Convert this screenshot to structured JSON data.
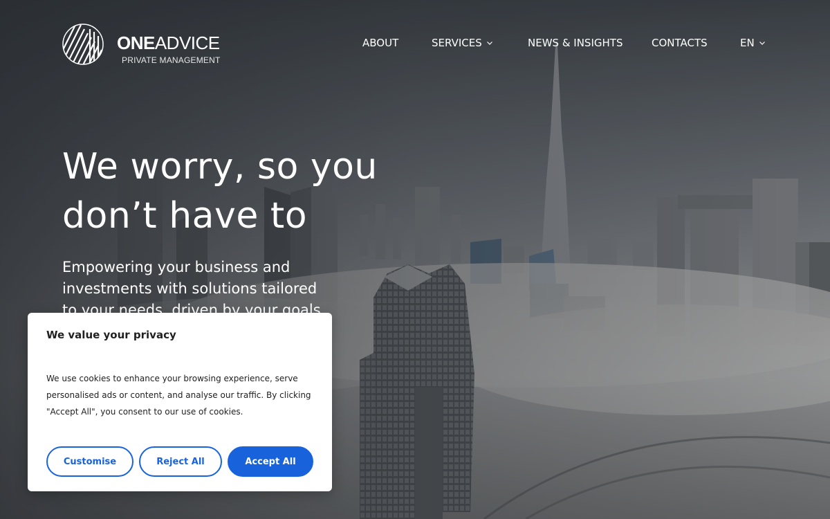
{
  "brand": {
    "name_bold": "ONE",
    "name_light": "ADVICE",
    "tagline": "PRIVATE MANAGEMENT",
    "logo_icon": "striped-circle-logo-icon"
  },
  "nav": {
    "about": "ABOUT",
    "services": "SERVICES",
    "news": "NEWS & INSIGHTS",
    "contacts": "CONTACTS",
    "language": "EN",
    "dropdown_icon": "chevron-down-icon"
  },
  "hero": {
    "title_line1": "We worry, so you",
    "title_line2": "don’t have to",
    "subtitle": "Empowering your business and investments with solutions tailored to your needs, driven by your goals"
  },
  "cookie_banner": {
    "title": "We value your privacy",
    "body": "We use cookies to enhance your browsing experience, serve personalised ads or content, and analyse our traffic. By clicking \"Accept All\", you consent to our use of cookies.",
    "customise_label": "Customise",
    "reject_label": "Reject All",
    "accept_label": "Accept All"
  },
  "colors": {
    "accent": "#1863dc",
    "text_dark": "#212121",
    "nav_text": "#ffffff"
  }
}
